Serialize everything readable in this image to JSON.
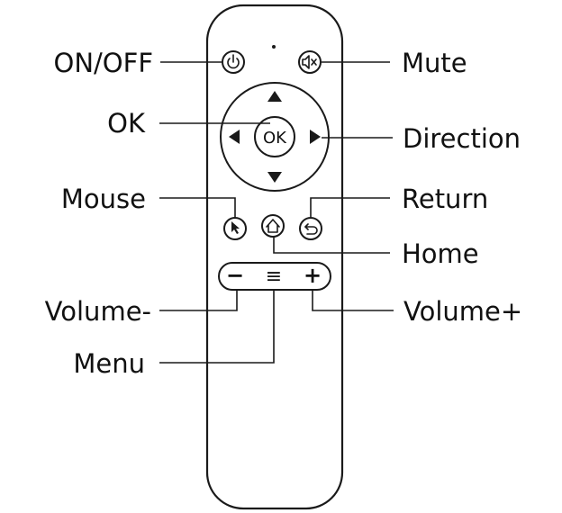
{
  "labels": {
    "on_off": "ON/OFF",
    "mute": "Mute",
    "ok": "OK",
    "direction": "Direction",
    "mouse": "Mouse",
    "return": "Return",
    "home": "Home",
    "volume_minus": "Volume-",
    "volume_plus": "Volume+",
    "menu": "Menu"
  },
  "buttons": {
    "ok_text": "OK",
    "minus_text": "−",
    "plus_text": "+",
    "menu_text": "≡"
  },
  "icons": {
    "power": "power-icon",
    "mute": "mute-icon",
    "up": "arrow-up-icon",
    "down": "arrow-down-icon",
    "left": "arrow-left-icon",
    "right": "arrow-right-icon",
    "mouse": "mouse-cursor-icon",
    "home": "home-icon",
    "return": "return-icon"
  }
}
